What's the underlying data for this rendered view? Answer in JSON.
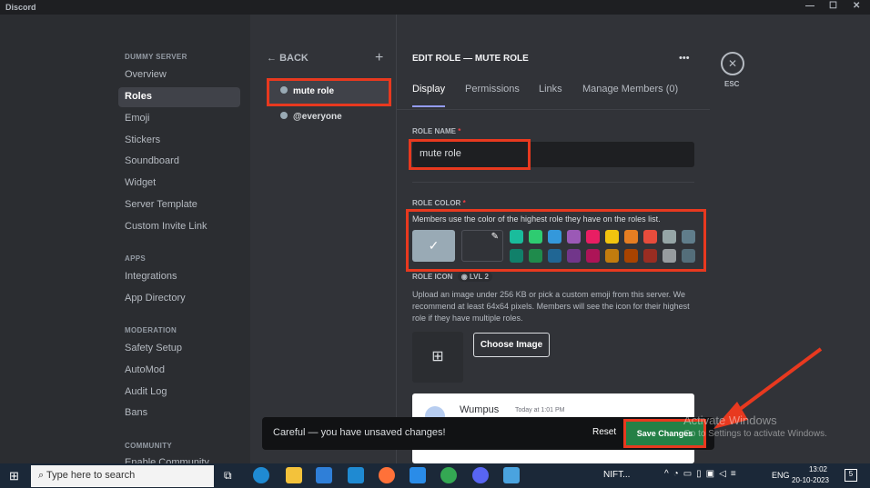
{
  "window": {
    "title": "Discord",
    "minimize": "—",
    "maximize": "☐",
    "close": "✕"
  },
  "sidebar": {
    "server_heading": "DUMMY SERVER",
    "items": [
      "Overview",
      "Roles",
      "Emoji",
      "Stickers",
      "Soundboard",
      "Widget",
      "Server Template",
      "Custom Invite Link"
    ],
    "apps_heading": "APPS",
    "apps_items": [
      "Integrations",
      "App Directory"
    ],
    "moderation_heading": "MODERATION",
    "moderation_items": [
      "Safety Setup",
      "AutoMod",
      "Audit Log",
      "Bans"
    ],
    "community_heading": "COMMUNITY",
    "community_items": [
      "Enable Community"
    ]
  },
  "roles": {
    "back": "BACK",
    "add": "+",
    "list": [
      "mute role",
      "@everyone"
    ]
  },
  "editor": {
    "title": "EDIT ROLE — MUTE ROLE",
    "more": "•••",
    "tabs": [
      "Display",
      "Permissions",
      "Links",
      "Manage Members (0)"
    ],
    "role_name_label": "ROLE NAME",
    "required": "*",
    "role_name_value": "mute role",
    "role_color_label": "ROLE COLOR",
    "role_color_desc": "Members use the color of the highest role they have on the roles list.",
    "default_color": "#99aab5",
    "checkmark": "✓",
    "colors_top": [
      "#1abc9c",
      "#2ecc71",
      "#3498db",
      "#9b59b6",
      "#e91e63",
      "#f1c40f",
      "#e67e22",
      "#e74c3c",
      "#95a5a6",
      "#607d8b"
    ],
    "colors_bottom": [
      "#11806a",
      "#1f8b4c",
      "#206694",
      "#71368a",
      "#ad1457",
      "#c27c0e",
      "#a84300",
      "#992d22",
      "#979c9f",
      "#546e7a"
    ],
    "role_icon_label": "ROLE ICON",
    "lvl": "LVL 2",
    "role_icon_desc": "Upload an image under 256 KB or pick a custom emoji from this server. We recommend at least 64x64 pixels. Members will see the icon for their highest role if they have multiple roles.",
    "choose_image": "Choose Image",
    "preview": {
      "name": "Wumpus",
      "time": "Today at 1:01 PM"
    }
  },
  "esc": {
    "icon": "✕",
    "label": "ESC"
  },
  "unsaved": {
    "message": "Careful — you have unsaved changes!",
    "reset": "Reset",
    "save": "Save Changes"
  },
  "watermark": {
    "title": "Activate Windows",
    "sub": "Go to Settings to activate Windows."
  },
  "taskbar": {
    "search_placeholder": "Type here to search",
    "stock": "NIFT...",
    "lang": "ENG",
    "time": "13:02",
    "date": "20-10-2023",
    "notifications": "5"
  }
}
